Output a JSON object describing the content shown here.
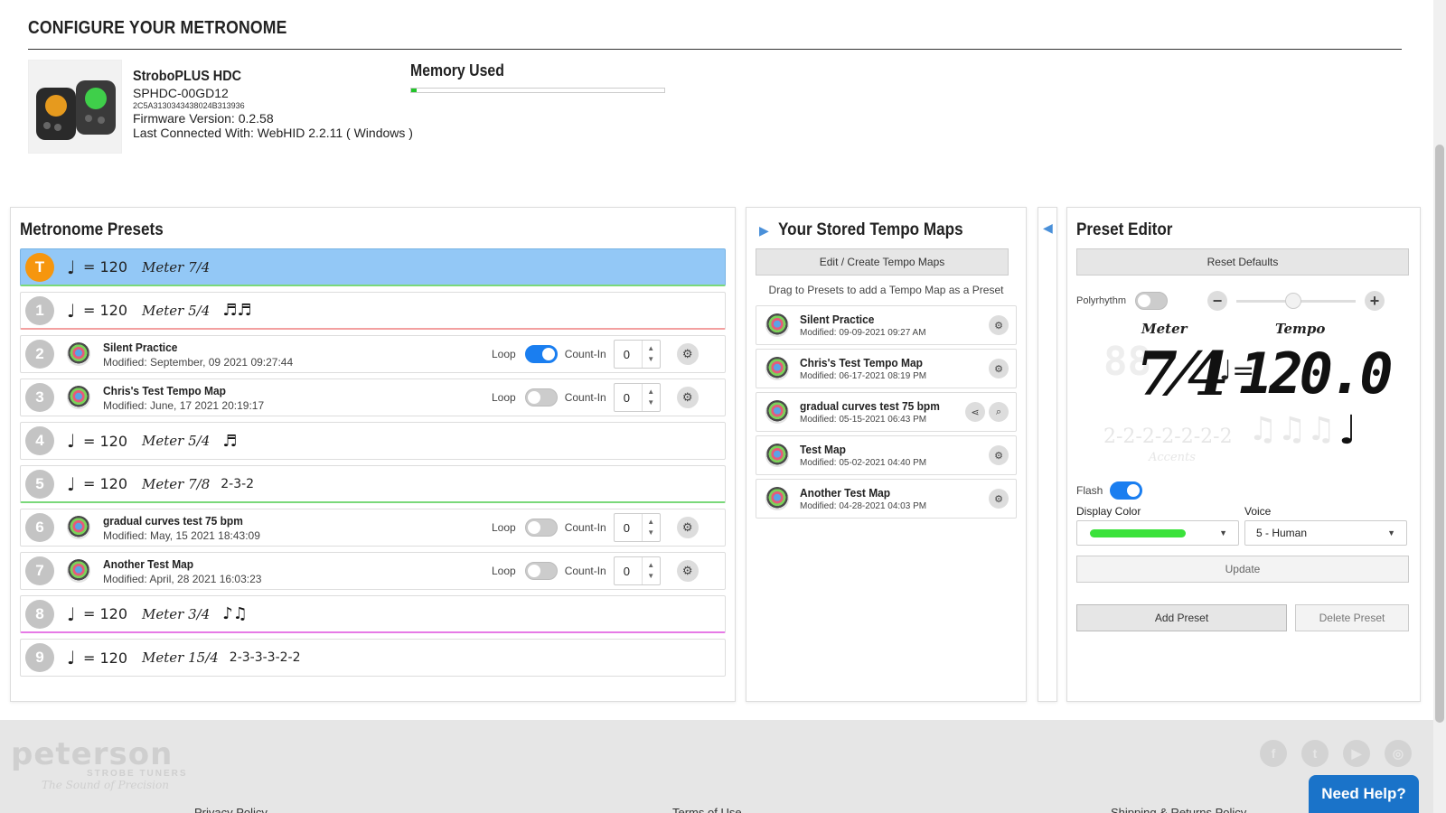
{
  "header": {
    "title": "CONFIGURE YOUR METRONOME"
  },
  "device": {
    "name": "StroboPLUS HDC",
    "model": "SPHDC-00GD12",
    "uid": "2C5A3130343438024B313936",
    "firmware": "Firmware Version: 0.2.58",
    "last_connected": "Last Connected With: WebHID 2.2.11 ( Windows )"
  },
  "memory": {
    "label": "Memory Used",
    "fraction": 0.02
  },
  "presets": {
    "title": "Metronome Presets",
    "items": [
      {
        "badge": "T",
        "kind": "meter",
        "note": "♩",
        "tempo": "= 120",
        "meter": "Meter 7/4",
        "rhythm": "",
        "accents": ""
      },
      {
        "badge": "1",
        "kind": "meter",
        "note": "♩",
        "tempo": "= 120",
        "meter": "Meter 5/4",
        "rhythm": "♬♬",
        "accents": ""
      },
      {
        "badge": "2",
        "kind": "map",
        "name": "Silent Practice",
        "modified": "Modified: September, 09 2021 09:27:44",
        "loop_label": "Loop",
        "loop_on": true,
        "countin_label": "Count-In",
        "countin": "0"
      },
      {
        "badge": "3",
        "kind": "map",
        "name": "Chris's Test Tempo Map",
        "modified": "Modified: June, 17 2021 20:19:17",
        "loop_label": "Loop",
        "loop_on": false,
        "countin_label": "Count-In",
        "countin": "0"
      },
      {
        "badge": "4",
        "kind": "meter",
        "note": "♩",
        "tempo": "= 120",
        "meter": "Meter 5/4",
        "rhythm": "♬",
        "accents": ""
      },
      {
        "badge": "5",
        "kind": "meter",
        "note": "♩",
        "tempo": "= 120",
        "meter": "Meter 7/8",
        "rhythm": "",
        "accents": "2-3-2"
      },
      {
        "badge": "6",
        "kind": "map",
        "name": "gradual curves test 75 bpm",
        "modified": "Modified: May, 15 2021 18:43:09",
        "loop_label": "Loop",
        "loop_on": false,
        "countin_label": "Count-In",
        "countin": "0"
      },
      {
        "badge": "7",
        "kind": "map",
        "name": "Another Test Map",
        "modified": "Modified: April, 28 2021 16:03:23",
        "loop_label": "Loop",
        "loop_on": false,
        "countin_label": "Count-In",
        "countin": "0"
      },
      {
        "badge": "8",
        "kind": "meter",
        "note": "♩",
        "tempo": "= 120",
        "meter": "Meter 3/4",
        "rhythm": "♪♫",
        "accents": ""
      },
      {
        "badge": "9",
        "kind": "meter",
        "note": "♩",
        "tempo": "= 120",
        "meter": "Meter 15/4",
        "rhythm": "",
        "accents": "2-3-3-3-2-2"
      }
    ]
  },
  "tempo_maps": {
    "title": "Your Stored Tempo Maps",
    "edit_button": "Edit / Create Tempo Maps",
    "hint": "Drag to Presets to add a Tempo Map as a Preset",
    "items": [
      {
        "name": "Silent Practice",
        "modified": "Modified: 09-09-2021 09:27 AM",
        "share": false
      },
      {
        "name": "Chris's Test Tempo Map",
        "modified": "Modified: 06-17-2021 08:19 PM",
        "share": false
      },
      {
        "name": "gradual curves test 75 bpm",
        "modified": "Modified: 05-15-2021 06:43 PM",
        "share": true
      },
      {
        "name": "Test Map",
        "modified": "Modified: 05-02-2021 04:40 PM",
        "share": false
      },
      {
        "name": "Another Test Map",
        "modified": "Modified: 04-28-2021 04:03 PM",
        "share": false
      }
    ]
  },
  "editor": {
    "title": "Preset Editor",
    "reset_button": "Reset Defaults",
    "polyrhythm_label": "Polyrhythm",
    "polyrhythm_on": false,
    "meter_label": "Meter",
    "tempo_label": "Tempo",
    "meter_value": "7⁄4",
    "tempo_value": "120.0",
    "accents_pattern": "2-2-2-2-2-2-2",
    "accents_label": "Accents",
    "flash_label": "Flash",
    "flash_on": true,
    "display_color_label": "Display Color",
    "display_color": "#3be23b",
    "voice_label": "Voice",
    "voice_value": "5 - Human",
    "update_button": "Update",
    "add_button": "Add Preset",
    "delete_button": "Delete Preset"
  },
  "footer": {
    "logo_word": "peterson",
    "logo_sub": "STROBE TUNERS",
    "logo_tag": "The Sound of Precision",
    "help_button": "Need Help?",
    "links": [
      "Privacy Policy",
      "Terms of Use",
      "Shipping & Returns Policy"
    ]
  }
}
